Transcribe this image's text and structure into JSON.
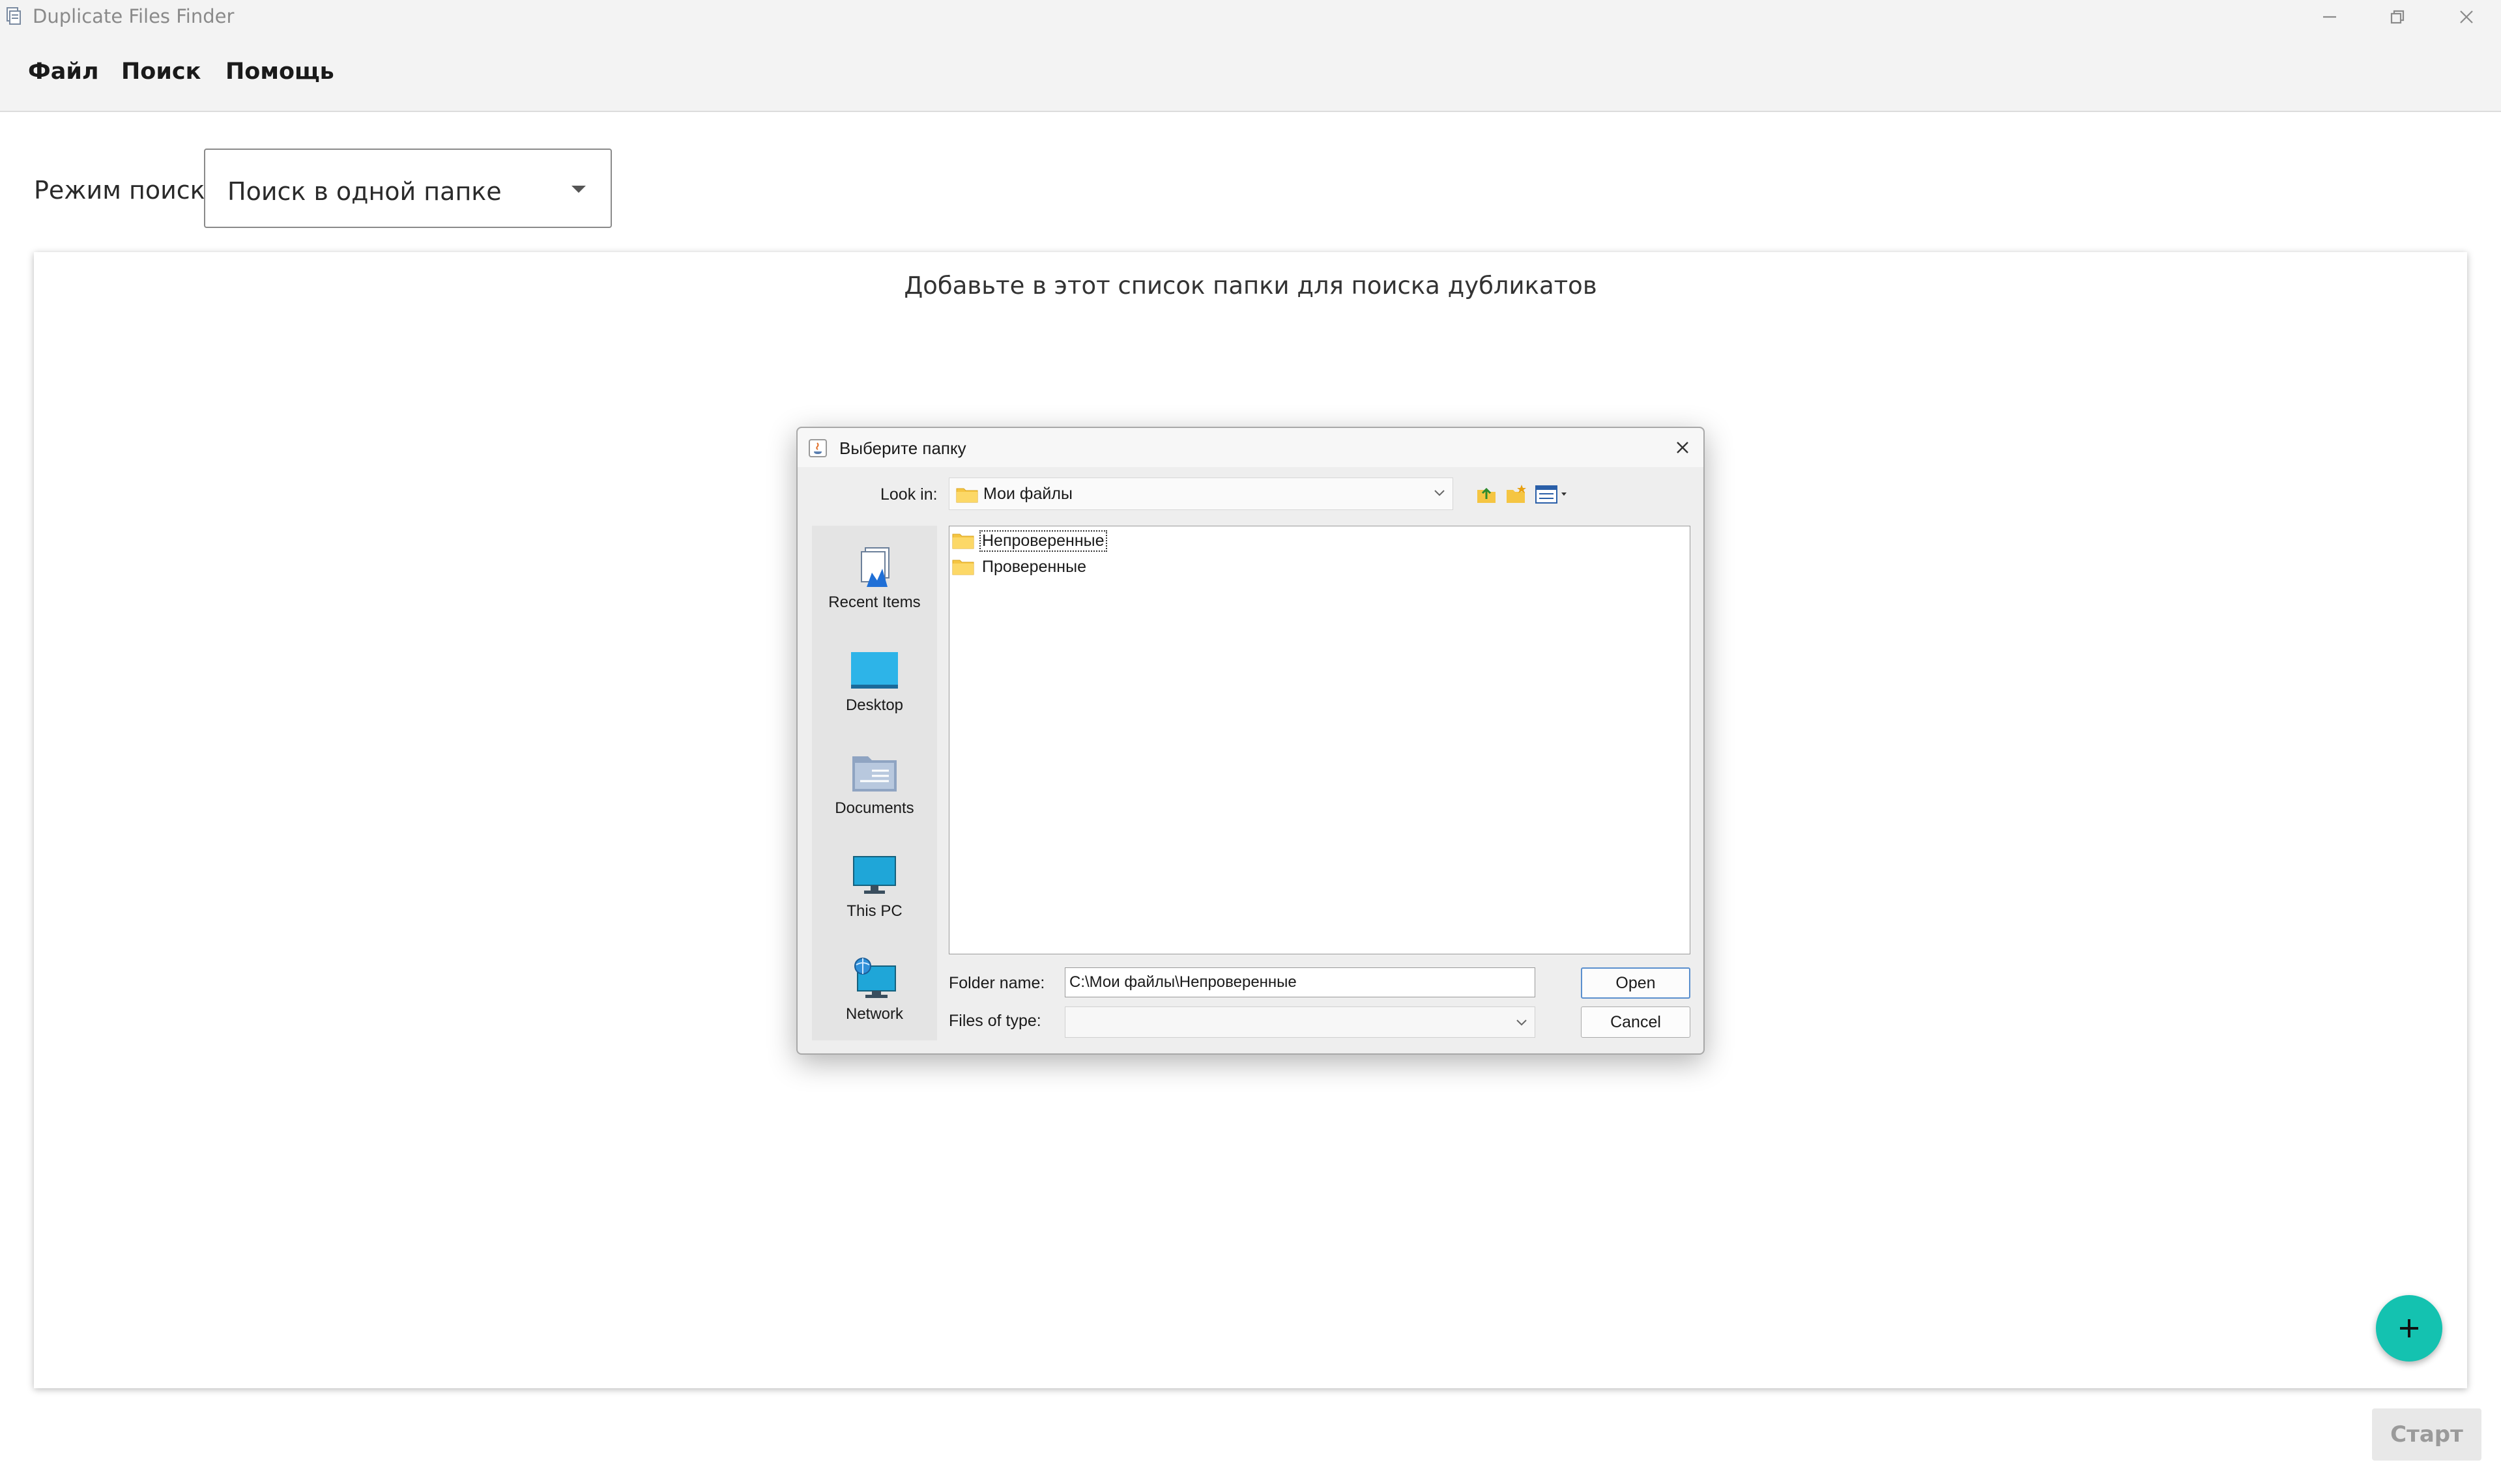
{
  "window": {
    "title": "Duplicate Files Finder"
  },
  "menu": {
    "file": "Файл",
    "search": "Поиск",
    "help": "Помощь"
  },
  "search_mode": {
    "label": "Режим поиска:",
    "value": "Поиск в одной папке"
  },
  "panel": {
    "hint": "Добавьте в этот список папки для поиска дубликатов"
  },
  "start_button": "Старт",
  "dialog": {
    "title": "Выберите папку",
    "look_in_label": "Look in:",
    "look_in_value": "Мои файлы",
    "places": [
      {
        "label": "Recent Items",
        "icon": "recent-items-icon"
      },
      {
        "label": "Desktop",
        "icon": "desktop-icon"
      },
      {
        "label": "Documents",
        "icon": "documents-icon"
      },
      {
        "label": "This PC",
        "icon": "this-pc-icon"
      },
      {
        "label": "Network",
        "icon": "network-icon"
      }
    ],
    "files": [
      {
        "name": "Непроверенные",
        "selected": true
      },
      {
        "name": "Проверенные",
        "selected": false
      }
    ],
    "folder_name_label": "Folder name:",
    "folder_name_value": "C:\\Мои файлы\\Непроверенные",
    "files_of_type_label": "Files of type:",
    "files_of_type_value": "",
    "open_button": "Open",
    "cancel_button": "Cancel"
  },
  "colors": {
    "accent_fab": "#14c2b0",
    "default_button_border": "#5a8fce"
  }
}
